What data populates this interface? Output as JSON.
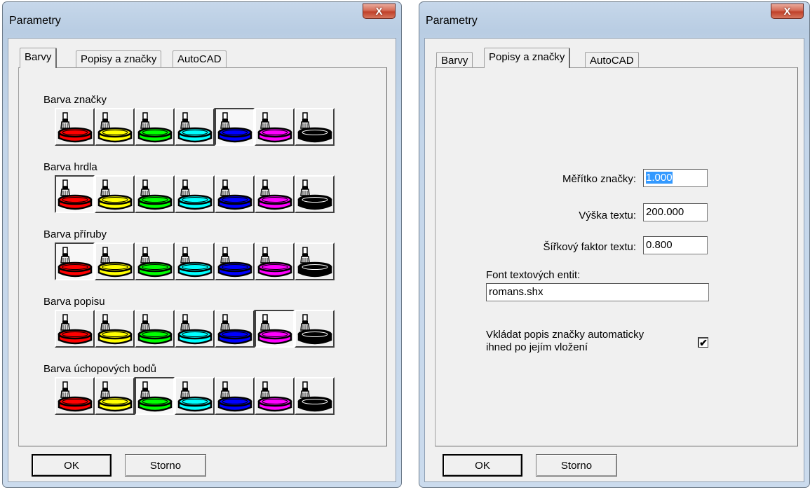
{
  "dialogs": [
    {
      "title": "Parametry",
      "close_glyph": "X",
      "tabs": [
        "Barvy",
        "Popisy a značky",
        "AutoCAD"
      ],
      "active_tab": 0,
      "groups": [
        {
          "label": "Barva značky",
          "selected": 4
        },
        {
          "label": "Barva hrdla",
          "selected": 0
        },
        {
          "label": "Barva příruby",
          "selected": 0
        },
        {
          "label": "Barva popisu",
          "selected": 5
        },
        {
          "label": "Barva úchopových bodů",
          "selected": 2
        }
      ],
      "ok_label": "OK",
      "cancel_label": "Storno"
    },
    {
      "title": "Parametry",
      "close_glyph": "X",
      "tabs": [
        "Barvy",
        "Popisy a značky",
        "AutoCAD"
      ],
      "active_tab": 1,
      "fields": {
        "scale_label": "Měřítko značky:",
        "scale_value": "1.000",
        "height_label": "Výška textu:",
        "height_value": "200.000",
        "width_label": "Šířkový faktor textu:",
        "width_value": "0.800",
        "font_label": "Font textových entit:",
        "font_value": "romans.shx",
        "auto_label_line1": "Vkládat popis značky automaticky",
        "auto_label_line2": "ihned po jejím vložení",
        "auto_checked": true,
        "check_glyph": "✔"
      },
      "ok_label": "OK",
      "cancel_label": "Storno"
    }
  ],
  "palette": [
    {
      "name": "red",
      "hex": "#ff0000"
    },
    {
      "name": "yellow",
      "hex": "#ffff00"
    },
    {
      "name": "green",
      "hex": "#00ff00"
    },
    {
      "name": "cyan",
      "hex": "#00ffff"
    },
    {
      "name": "blue",
      "hex": "#0000ff"
    },
    {
      "name": "magenta",
      "hex": "#ff00ff"
    },
    {
      "name": "black",
      "hex": "#000000"
    }
  ],
  "icon": "paint-bucket-brush-icon",
  "colors": {
    "titlebar": "#bfd2e8",
    "close_button": "#c94a35",
    "face": "#f0f0f0",
    "selection": "#3399ff"
  }
}
